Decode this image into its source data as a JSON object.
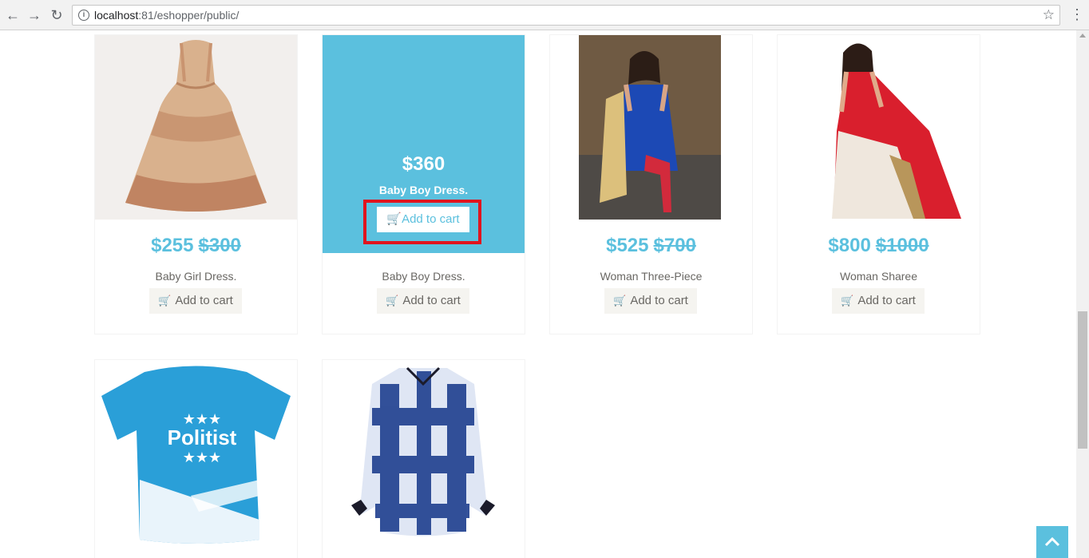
{
  "browser": {
    "url_host": "localhost",
    "url_rest": ":81/eshopper/public/"
  },
  "products": [
    {
      "price": "$255",
      "old_price": "$300",
      "name": "Baby Girl Dress.",
      "cart_label": "Add to cart"
    },
    {
      "price": "$360",
      "name": "Baby Boy Dress.",
      "cart_label": "Add to cart"
    },
    {
      "price": "$525",
      "old_price": "$700",
      "name": "Woman Three-Piece",
      "cart_label": "Add to cart"
    },
    {
      "price": "$800",
      "old_price": "$1000",
      "name": "Woman Sharee",
      "cart_label": "Add to cart"
    }
  ],
  "overlay": {
    "price": "$360",
    "name": "Baby Boy Dress.",
    "cart_label": "Add to cart"
  },
  "second_row": [
    {
      "image": "t-shirt-politist",
      "print_text": "Politist"
    },
    {
      "image": "plaid-shirt"
    }
  ],
  "colors": {
    "accent": "#5bc0de",
    "highlight": "#e0141e"
  }
}
